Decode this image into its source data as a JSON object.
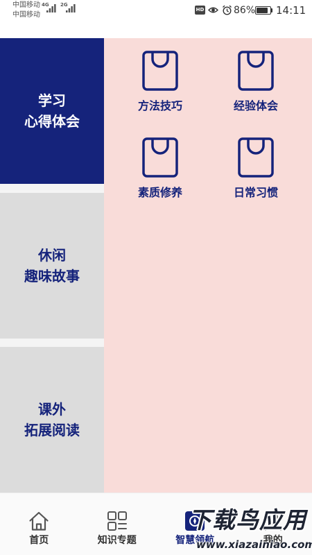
{
  "status_bar": {
    "carrier_1": "中国移动",
    "carrier_2": "中国移动",
    "network_1": "4G",
    "network_2": "2G",
    "hd_badge": "HD",
    "battery_percent": "86%",
    "battery_level": 0.86,
    "time": "14:11",
    "icons": [
      "signal-icon",
      "eye-icon",
      "alarm-icon",
      "battery-icon"
    ]
  },
  "sidebar": {
    "items": [
      {
        "line1": "学习",
        "line2": "心得体会",
        "selected": true
      },
      {
        "line1": "休闲",
        "line2": "趣味故事",
        "selected": false
      },
      {
        "line1": "课外",
        "line2": "拓展阅读",
        "selected": false
      }
    ]
  },
  "content": {
    "items": [
      {
        "label": "方法技巧",
        "icon": "shopping-bag-icon"
      },
      {
        "label": "经验体会",
        "icon": "shopping-bag-icon"
      },
      {
        "label": "素质修养",
        "icon": "shopping-bag-icon"
      },
      {
        "label": "日常习惯",
        "icon": "shopping-bag-icon"
      }
    ]
  },
  "tabbar": {
    "tabs": [
      {
        "label": "首页",
        "icon": "home-icon",
        "active": false
      },
      {
        "label": "知识专题",
        "icon": "grid-icon",
        "active": false
      },
      {
        "label": "智慧领航",
        "icon": "navigation-icon",
        "active": true
      },
      {
        "label": "我的",
        "icon": "person-icon",
        "active": false
      }
    ]
  },
  "watermark": {
    "title": "下载鸟应用",
    "url": "www.xiazainiao.com"
  },
  "colors": {
    "navy": "#15237b",
    "pink": "#f9dcd9",
    "sidebar_gray": "#dcdcdc"
  }
}
